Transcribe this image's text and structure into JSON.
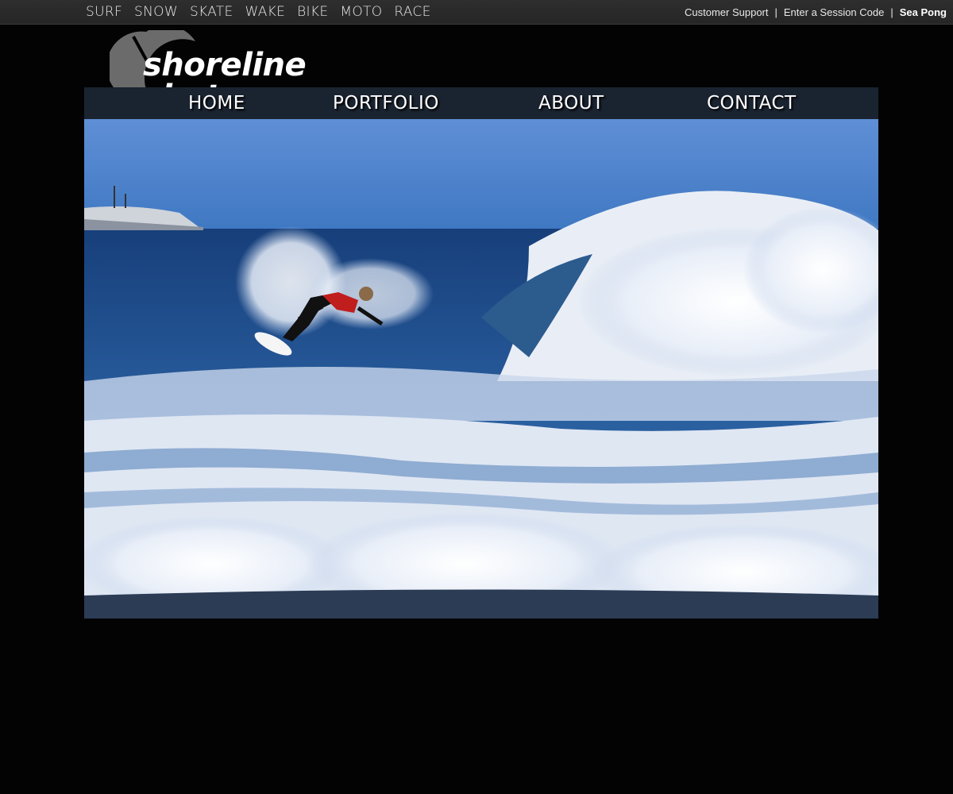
{
  "sport_nav": [
    "SURF",
    "SNOW",
    "SKATE",
    "WAKE",
    "BIKE",
    "MOTO",
    "RACE"
  ],
  "util_nav": {
    "support": "Customer Support",
    "session": "Enter a Session Code",
    "user": "Sea Pong",
    "separator": "|"
  },
  "logo": {
    "text": "shoreline shots",
    "mark": "camera-aperture-logo"
  },
  "main_nav": {
    "home": "HOME",
    "portfolio": "PORTFOLIO",
    "about": "ABOUT",
    "contact": "CONTACT"
  },
  "hero": {
    "subject": "surfer-riding-wave-photo"
  },
  "colors": {
    "background": "#030303",
    "topbar": "#2a2a2a",
    "nav_bar": "#1a2330",
    "logo_mark": "#6b6b6b",
    "text": "#ffffff"
  }
}
